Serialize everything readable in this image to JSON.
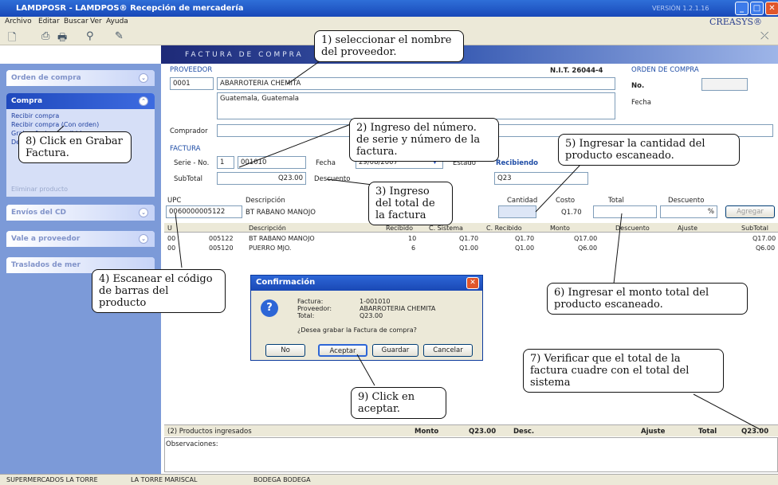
{
  "window": {
    "title": "LAMDPOSR - LAMDPOS® Recepción de mercadería",
    "version": "VERSIÓN 1.2.1.16",
    "brand": "CREASYS®"
  },
  "menu": [
    "Archivo",
    "Editar",
    "Buscar",
    "Ver",
    "Ayuda"
  ],
  "banner": "FACTURA DE COMPRA",
  "sidebar": {
    "orden": "Orden de compra",
    "compra": {
      "title": "Compra",
      "items": [
        "Recibir compra",
        "Recibir compra (Con orden)",
        "Grabar factura recibida",
        "Devolución a factura"
      ]
    },
    "hidden_item": "Eliminar producto",
    "envios": "Envíos del CD",
    "vale": "Vale a proveedor",
    "traslados": "Traslados de mer"
  },
  "proveedor": {
    "label": "PROVEEDOR",
    "code": "0001",
    "name": "ABARROTERIA CHEMITA",
    "address": "Guatemala, Guatemala",
    "nit": "N.I.T. 26044-4",
    "comprador_label": "Comprador"
  },
  "orden": {
    "label": "ORDEN DE COMPRA",
    "no_label": "No.",
    "fecha_label": "Fecha"
  },
  "factura": {
    "label": "FACTURA",
    "serie_label": "Serie - No.",
    "serie": "1",
    "numero": "001010",
    "fecha_label": "Fecha",
    "fecha": "29/08/2007",
    "estado_label": "Estado",
    "estado": "Recibiendo",
    "subtotal_label": "SubTotal",
    "subtotal": "Q23.00",
    "descuento_label": "Descuento",
    "total_partial": "Q23"
  },
  "entry": {
    "upc_label": "UPC",
    "desc_label": "Descripción",
    "cantidad_label": "Cantidad",
    "costo_label": "Costo",
    "total_label": "Total",
    "descuento_label": "Descuento",
    "upc": "0060000005122",
    "desc": "BT RABANO MANOJO",
    "costo": "Q1.70",
    "pct": "%",
    "agregar": "Agregar"
  },
  "grid": {
    "headers": [
      "U",
      "Descripción",
      "Recibido",
      "C. Sistema",
      "C. Recibido",
      "Monto",
      "Descuento",
      "Ajuste",
      "SubTotal"
    ],
    "rows": [
      [
        "00",
        "005122",
        "BT RABANO MANOJO",
        "10",
        "Q1.70",
        "Q1.70",
        "Q17.00",
        "",
        "",
        "Q17.00"
      ],
      [
        "00",
        "005120",
        "PUERRO MJO.",
        "6",
        "Q1.00",
        "Q1.00",
        "Q6.00",
        "",
        "",
        "Q6.00"
      ]
    ]
  },
  "totals": {
    "productos": "(2) Productos ingresados",
    "monto_label": "Monto",
    "monto": "Q23.00",
    "desc_label": "Desc.",
    "ajuste_label": "Ajuste",
    "total_label": "Total",
    "total": "Q23.00",
    "obs_label": "Observaciones:"
  },
  "dialog": {
    "title": "Confirmación",
    "factura_label": "Factura:",
    "factura": "1-001010",
    "proveedor_label": "Proveedor:",
    "proveedor": "ABARROTERIA CHEMITA",
    "total_label": "Total:",
    "total": "Q23.00",
    "question": "¿Desea grabar la Factura de compra?",
    "buttons": [
      "No",
      "Aceptar",
      "Guardar",
      "Cancelar"
    ]
  },
  "callouts": {
    "c1": "1) seleccionar el nombre del proveedor.",
    "c2": "2) Ingreso del número. de serie y número de la factura.",
    "c3": "3) Ingreso del total de la factura",
    "c4": "4) Escanear el código de barras del producto",
    "c5": "5) Ingresar la cantidad del producto escaneado.",
    "c6": "6) Ingresar el monto total del producto escaneado.",
    "c7": "7) Verificar que el total de la factura cuadre con el total del sistema",
    "c8": "8) Click en Grabar Factura.",
    "c9": "9) Click en aceptar."
  },
  "status": [
    "SUPERMERCADOS LA TORRE",
    "LA TORRE MARISCAL",
    "BODEGA BODEGA"
  ]
}
